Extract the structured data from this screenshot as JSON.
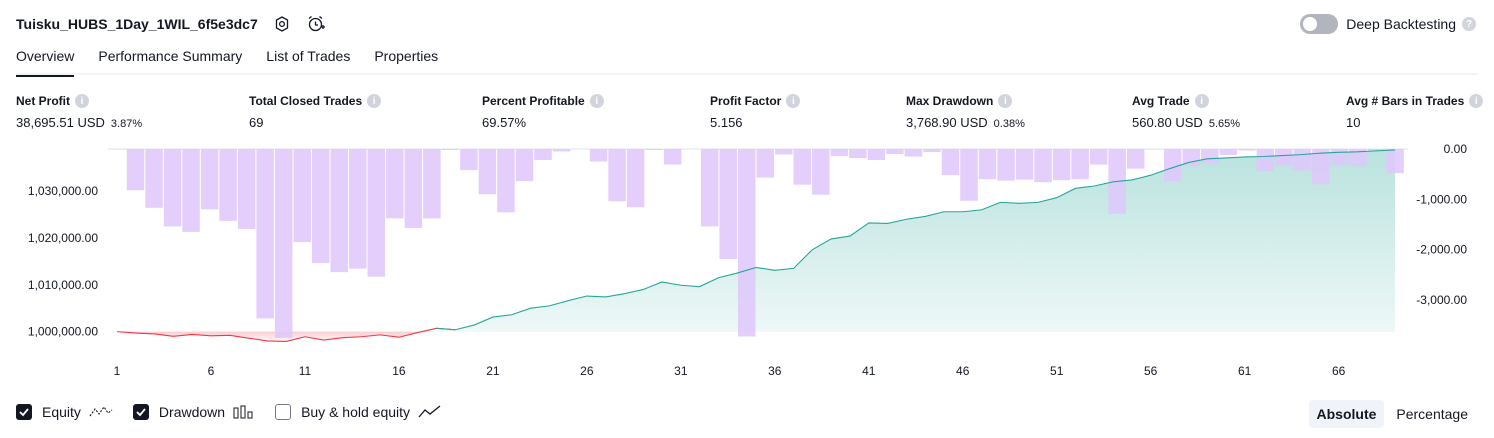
{
  "header": {
    "title": "Tuisku_HUBS_1Day_1WIL_6f5e3dc7",
    "settings_icon": "gear-icon",
    "alert_icon": "alarm-add-icon"
  },
  "deep_backtesting": {
    "label": "Deep Backtesting",
    "enabled": false
  },
  "tabs": [
    {
      "label": "Overview",
      "active": true
    },
    {
      "label": "Performance Summary",
      "active": false
    },
    {
      "label": "List of Trades",
      "active": false
    },
    {
      "label": "Properties",
      "active": false
    }
  ],
  "metrics": {
    "net_profit": {
      "label": "Net Profit",
      "value": "38,695.51 USD",
      "pct": "3.87%"
    },
    "total_closed_trades": {
      "label": "Total Closed Trades",
      "value": "69"
    },
    "percent_profitable": {
      "label": "Percent Profitable",
      "value": "69.57%"
    },
    "profit_factor": {
      "label": "Profit Factor",
      "value": "5.156"
    },
    "max_drawdown": {
      "label": "Max Drawdown",
      "value": "3,768.90 USD",
      "pct": "0.38%"
    },
    "avg_trade": {
      "label": "Avg Trade",
      "value": "560.80 USD",
      "pct": "5.65%"
    },
    "avg_bars": {
      "label": "Avg # Bars in Trades",
      "value": "10"
    }
  },
  "chart_data": {
    "type": "area",
    "x_ticks": [
      "1",
      "6",
      "11",
      "16",
      "21",
      "26",
      "31",
      "36",
      "41",
      "46",
      "51",
      "56",
      "61",
      "66"
    ],
    "left_ticks": [
      "1,030,000.00",
      "1,020,000.00",
      "1,010,000.00",
      "1,000,000.00"
    ],
    "left_tick_values": [
      1030000,
      1020000,
      1010000,
      1000000
    ],
    "right_ticks": [
      "0.00",
      "-1,000.00",
      "-2,000.00",
      "-3,000.00"
    ],
    "right_tick_values": [
      0,
      -1000,
      -2000,
      -3000
    ],
    "left_ylim": [
      996500,
      1039000
    ],
    "right_ylim": [
      -3760,
      0
    ],
    "x_range": [
      1,
      69
    ],
    "series": [
      {
        "name": "Equity",
        "values": [
          1000000,
          999700,
          999500,
          999000,
          999400,
          999100,
          999200,
          998600,
          998000,
          997900,
          998900,
          998200,
          998700,
          998900,
          999300,
          998800,
          999800,
          1000700,
          1000400,
          1001400,
          1003100,
          1003600,
          1005000,
          1005500,
          1006600,
          1007600,
          1007400,
          1008100,
          1009000,
          1010600,
          1009900,
          1009600,
          1011500,
          1012500,
          1013700,
          1013100,
          1013500,
          1017500,
          1019800,
          1020400,
          1023200,
          1023100,
          1024000,
          1024600,
          1025600,
          1025600,
          1026000,
          1027600,
          1027400,
          1027600,
          1028600,
          1030600,
          1031100,
          1032000,
          1032400,
          1033400,
          1034800,
          1036100,
          1036900,
          1037100,
          1037300,
          1037400,
          1037600,
          1037800,
          1038100,
          1038300,
          1038400,
          1038600,
          1038800
        ]
      },
      {
        "name": "Drawdown",
        "values": [
          -10,
          -820,
          -1170,
          -1540,
          -1650,
          -1200,
          -1430,
          -1590,
          -3370,
          -3760,
          -1850,
          -2270,
          -2450,
          -2380,
          -2540,
          -1380,
          -1570,
          -1380,
          -20,
          -420,
          -900,
          -1260,
          -640,
          -220,
          -50,
          0,
          -250,
          -1040,
          -1160,
          -20,
          -310,
          0,
          -1540,
          -2190,
          -3730,
          -570,
          -110,
          -710,
          -910,
          -140,
          -180,
          -220,
          -100,
          -150,
          -60,
          -520,
          -1030,
          -600,
          -630,
          -610,
          -660,
          -620,
          -600,
          -310,
          -1290,
          -390,
          -10,
          -640,
          -340,
          -290,
          -120,
          -30,
          -440,
          -330,
          -430,
          -700,
          -320,
          -340,
          -30,
          -480
        ]
      }
    ]
  },
  "legend": {
    "equity": {
      "label": "Equity",
      "checked": true
    },
    "drawdown": {
      "label": "Drawdown",
      "checked": true
    },
    "buy_hold": {
      "label": "Buy & hold equity",
      "checked": false
    }
  },
  "modes": {
    "absolute": "Absolute",
    "percentage": "Percentage",
    "active": "absolute"
  },
  "colors": {
    "green": "#089981",
    "red": "#f23645",
    "drawdown_bar": "#dfc7fb",
    "equity_line": "#26a69a",
    "equity_neg": "#f23645"
  }
}
